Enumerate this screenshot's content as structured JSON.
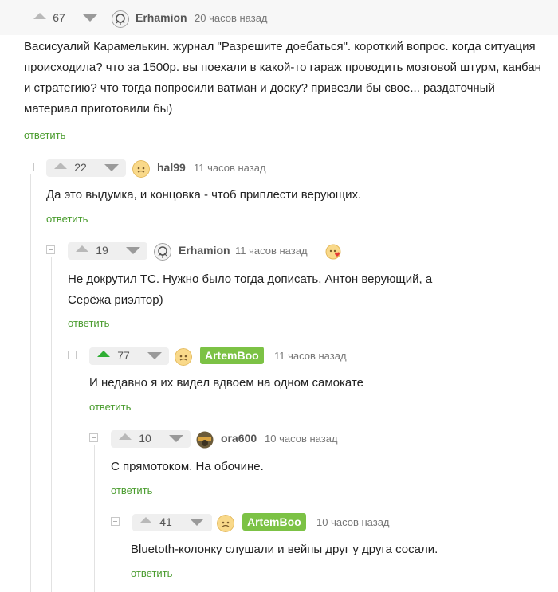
{
  "comments": [
    {
      "score": "67",
      "author": "Erhamion",
      "time": "20 часов назад",
      "text": "Васисуалий Карамелькин. журнал \"Разрешите доебаться\". короткий вопрос. когда ситуация происходила? что за 1500р. вы поехали в какой-то гараж проводить мозговой штурм, канбан и стратегию? что тогда попросили ватман и доску? привезли бы свое... раздаточный материал приготовили бы)",
      "reply": "ответить"
    },
    {
      "score": "22",
      "author": "hal99",
      "time": "11 часов назад",
      "text": "Да это выдумка, и концовка - чтоб приплести верующих.",
      "reply": "ответить"
    },
    {
      "score": "19",
      "author": "Erhamion",
      "time": "11 часов назад",
      "text": "Не докрутил ТС. Нужно было тогда дописать, Антон верующий, а Серёжа риэлтор)",
      "reply": "ответить"
    },
    {
      "score": "77",
      "author": "ArtemBoo",
      "time": "11 часов назад",
      "text": "И недавно я их видел вдвоем на одном самокате",
      "reply": "ответить"
    },
    {
      "score": "10",
      "author": "ora600",
      "time": "10 часов назад",
      "text": "С прямотоком. На обочине.",
      "reply": "ответить"
    },
    {
      "score": "41",
      "author": "ArtemBoo",
      "time": "10 часов назад",
      "text": "Bluetoth-колонку слушали и вейпы друг у друга сосали.",
      "reply": "ответить"
    }
  ],
  "colors": {
    "reply_link": "#4a9c2e",
    "author_badge": "#7cc245",
    "upvote_active": "#2fae34"
  },
  "icons": {
    "upvote": "up-arrow-icon",
    "downvote": "down-arrow-icon",
    "collapse": "collapse-minus-icon",
    "reaction": "heart-face-icon"
  }
}
